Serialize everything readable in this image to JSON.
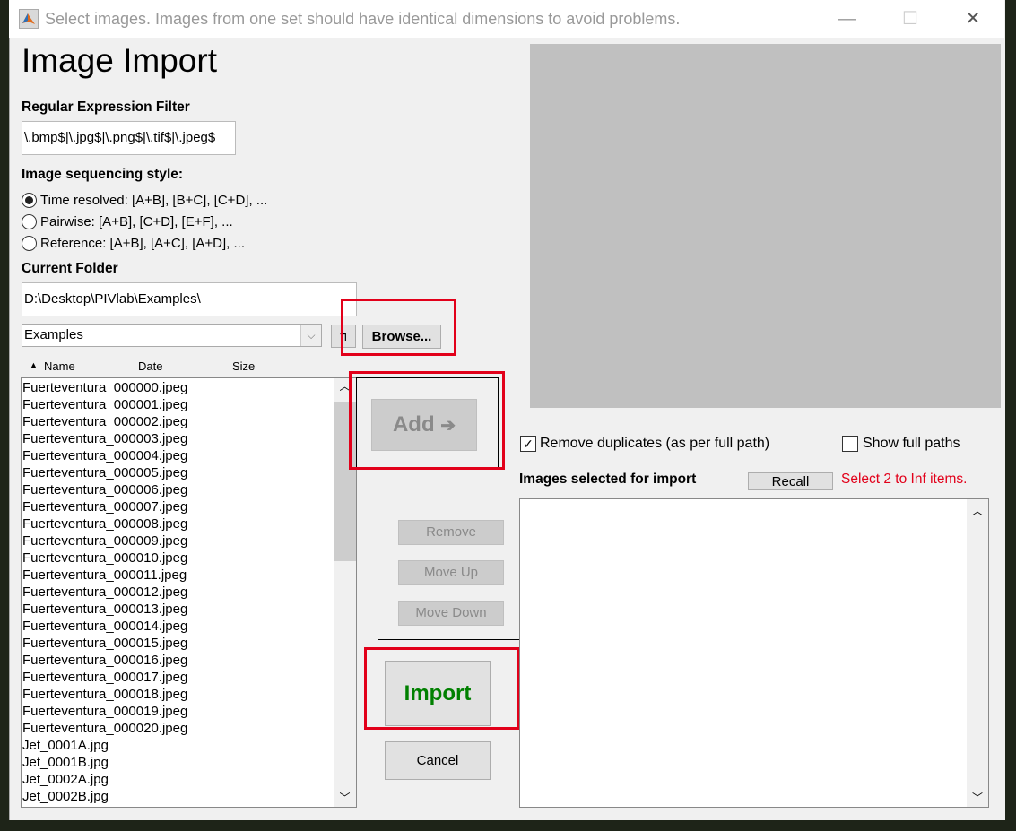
{
  "window": {
    "title": "Select images. Images from one set should have identical dimensions to avoid problems.",
    "minimize": "—",
    "maximize": "☐",
    "close": "✕"
  },
  "heading": "Image Import",
  "regex": {
    "label": "Regular Expression Filter",
    "value": "\\.bmp$|\\.jpg$|\\.png$|\\.tif$|\\.jpeg$"
  },
  "sequencing": {
    "label": "Image sequencing style:",
    "options": [
      {
        "label": "Time resolved: [A+B], [B+C], [C+D], ...",
        "selected": true
      },
      {
        "label": "Pairwise: [A+B], [C+D], [E+F], ...",
        "selected": false
      },
      {
        "label": "Reference: [A+B], [A+C], [A+D], ...",
        "selected": false
      }
    ]
  },
  "folder": {
    "label": "Current Folder",
    "path": "D:\\Desktop\\PIVlab\\Examples\\",
    "dropdown": "Examples",
    "up_icon": "folder-up-icon",
    "browse": "Browse..."
  },
  "file_list": {
    "columns": [
      "Name",
      "Date",
      "Size"
    ],
    "sort_icon": "sort-ascending-icon",
    "items": [
      "Fuerteventura_000000.jpeg",
      "Fuerteventura_000001.jpeg",
      "Fuerteventura_000002.jpeg",
      "Fuerteventura_000003.jpeg",
      "Fuerteventura_000004.jpeg",
      "Fuerteventura_000005.jpeg",
      "Fuerteventura_000006.jpeg",
      "Fuerteventura_000007.jpeg",
      "Fuerteventura_000008.jpeg",
      "Fuerteventura_000009.jpeg",
      "Fuerteventura_000010.jpeg",
      "Fuerteventura_000011.jpeg",
      "Fuerteventura_000012.jpeg",
      "Fuerteventura_000013.jpeg",
      "Fuerteventura_000014.jpeg",
      "Fuerteventura_000015.jpeg",
      "Fuerteventura_000016.jpeg",
      "Fuerteventura_000017.jpeg",
      "Fuerteventura_000018.jpeg",
      "Fuerteventura_000019.jpeg",
      "Fuerteventura_000020.jpeg",
      "Jet_0001A.jpg",
      "Jet_0001B.jpg",
      "Jet_0002A.jpg",
      "Jet_0002B.jpg"
    ]
  },
  "buttons": {
    "add": "Add",
    "add_arrow": "➔",
    "remove": "Remove",
    "move_up": "Move Up",
    "move_down": "Move Down",
    "import": "Import",
    "cancel": "Cancel",
    "recall": "Recall"
  },
  "options": {
    "remove_duplicates": {
      "label": "Remove duplicates (as per full path)",
      "checked": true
    },
    "show_full_paths": {
      "label": "Show full paths",
      "checked": false
    }
  },
  "selected": {
    "label": "Images selected for import",
    "status": "Select 2 to Inf items.",
    "items": []
  },
  "colors": {
    "import_text": "#008000",
    "status_text": "#e2001a",
    "highlight": "#e2001a",
    "preview": "#c0c0c0"
  }
}
